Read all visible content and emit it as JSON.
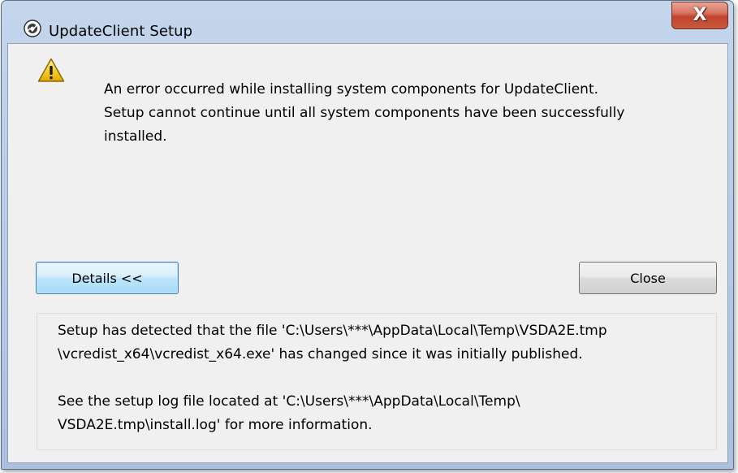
{
  "window": {
    "title": "UpdateClient Setup",
    "app_icon": "setup-disc-icon",
    "close_glyph": "X"
  },
  "message": {
    "icon": "warning-icon",
    "line1": "An error occurred while installing system components for UpdateClient.",
    "line2": "Setup cannot continue until all system components have been successfully",
    "line3": "installed."
  },
  "buttons": {
    "details_label": "Details <<",
    "close_label": "Close"
  },
  "details": {
    "p1_line1": "Setup has detected that the file 'C:\\Users\\***\\AppData\\Local\\Temp\\VSDA2E.tmp",
    "p1_line2": "\\vcredist_x64\\vcredist_x64.exe' has changed since it was initially published.",
    "p2_line1": "See the setup log file located at 'C:\\Users\\***\\AppData\\Local\\Temp\\",
    "p2_line2": "VSDA2E.tmp\\install.log' for more information."
  },
  "colors": {
    "frame": "#b9cde7",
    "client_bg": "#f0f0f0",
    "close_red": "#c0442c",
    "focus_blue": "#3c7fb1"
  }
}
